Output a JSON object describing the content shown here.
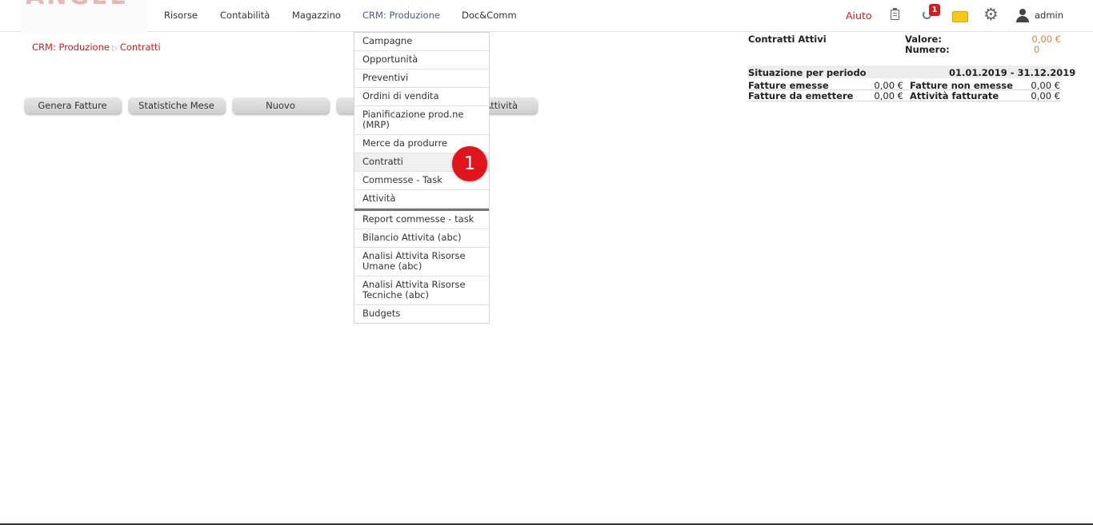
{
  "header": {
    "nav": [
      "Risorse",
      "Contabilità",
      "Magazzino",
      "CRM: Produzione",
      "Doc&Comm"
    ],
    "help_label": "Aiuto",
    "notification_count": "1",
    "user_name": "admin"
  },
  "breadcrumb": {
    "section": "CRM: Produzione",
    "separator": "▷",
    "page": "Contratti"
  },
  "toolbar": {
    "buttons": [
      "Genera Fatture",
      "Statistiche Mese",
      "Nuovo",
      "Attività"
    ]
  },
  "dropdown": {
    "items": [
      "Campagne",
      "Opportunità",
      "Preventivi",
      "Ordini di vendita",
      "Pianificazione prod.ne (MRP)",
      "Merce da produrre",
      "Contratti",
      "Commesse - Task",
      "Attività",
      "Report commesse - task",
      "Bilancio Attivita (abc)",
      "Analisi Attivita Risorse Umane (abc)",
      "Analisi Attivita Risorse Tecniche (abc)",
      "Budgets"
    ]
  },
  "step_marker": "1",
  "summary": {
    "active_title": "Contratti Attivi",
    "value_label": "Valore:",
    "value": "0,00 €",
    "count_label": "Numero:",
    "count": "0",
    "period_label": "Situazione per periodo",
    "period_range": "01.01.2019 - 31.12.2019",
    "rows": [
      {
        "l1": "Fatture emesse",
        "v1": "0,00 €",
        "l2": "Fatture non emesse",
        "v2": "0,00 €"
      },
      {
        "l1": "Fatture da emettere",
        "v1": "0,00 €",
        "l2": "Attività fatturate",
        "v2": "0,00 €"
      }
    ]
  },
  "colors": {
    "accent_red": "#d21a1a",
    "amount_orange": "#c9883c",
    "active_nav": "#4a5b84"
  }
}
